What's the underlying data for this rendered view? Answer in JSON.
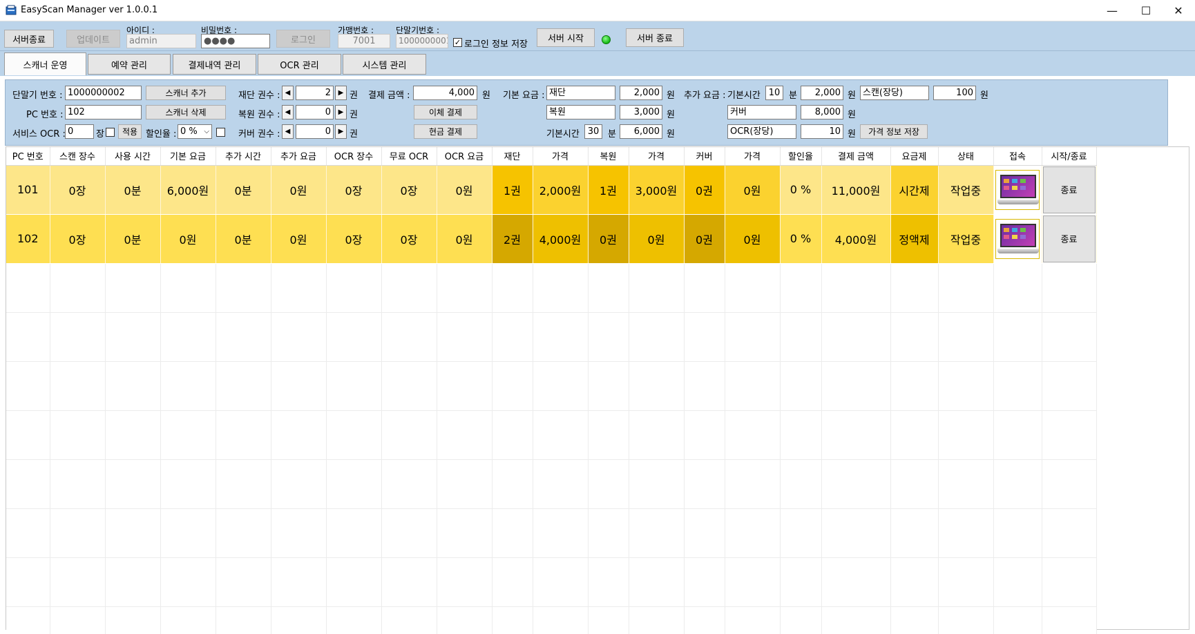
{
  "window": {
    "title": "EasyScan Manager ver 1.0.0.1",
    "minimize": "—",
    "maximize": "☐",
    "close": "✕"
  },
  "login_bar": {
    "server_exit_label": "서버종료",
    "update_label": "업데이트",
    "id_label": "아이디 :",
    "id_value": "admin",
    "password_label": "비밀번호 :",
    "password_value": "●●●●",
    "login_label": "로그인",
    "store_no_label": "가맹번호 :",
    "store_no_value": "7001",
    "terminal_no_label": "단말기번호 :",
    "terminal_no_value": "1000000001",
    "save_login_checked": "✓",
    "save_login_label": "로그인 정보 저장",
    "server_start_label": "서버 시작",
    "server_stop_label": "서버 종료",
    "status_led_color": "#14b814"
  },
  "tabs": [
    "스캐너 운영",
    "예약 관리",
    "결제내역 관리",
    "OCR 관리",
    "시스템 관리"
  ],
  "panel": {
    "terminal_label": "단말기 번호 :",
    "terminal_value": "1000000002",
    "add_scanner_label": "스캐너 추가",
    "pc_label": "PC 번호 :",
    "pc_value": "102",
    "delete_scanner_label": "스캐너 삭제",
    "service_ocr_label": "서비스 OCR :",
    "service_ocr_value": "0",
    "service_ocr_unit": "장",
    "apply_label": "적용",
    "discount_label": "할인율 :",
    "discount_value": "0 %",
    "cut_count_label": "재단 권수 :",
    "cut_count_value": "2",
    "copy_count_label": "복원 권수 :",
    "copy_count_value": "0",
    "cover_count_label": "커버 권수 :",
    "cover_count_value": "0",
    "count_unit": "권",
    "pay_amount_label": "결제 금액 :",
    "pay_amount_value": "4,000",
    "won": "원",
    "transfer_pay_label": "이체 결제",
    "cash_pay_label": "현금 결제",
    "base_fee_label": "기본 요금 :",
    "base_cut_name": "재단",
    "base_cut_price": "2,000",
    "base_copy_name": "복원",
    "base_copy_price": "3,000",
    "base_time_label": "기본시간",
    "base_time_value": "30",
    "base_time_unit": "분",
    "base_time_price": "6,000",
    "extra_fee_label": "추가 요금 :",
    "extra_time_label": "기본시간",
    "extra_time_value": "10",
    "extra_time_unit": "분",
    "extra_time_price": "2,000",
    "scan_name": "스캔(장당)",
    "scan_price": "100",
    "cover_name": "커버",
    "cover_price": "8,000",
    "ocr_name": "OCR(장당)",
    "ocr_price": "10",
    "save_price_label": "가격 정보 저장"
  },
  "grid": {
    "columns": [
      "PC 번호",
      "스캔 장수",
      "사용 시간",
      "기본 요금",
      "추가 시간",
      "추가 요금",
      "OCR 장수",
      "무료 OCR",
      "OCR 요금",
      "재단",
      "가격",
      "복원",
      "가격",
      "커버",
      "가격",
      "할인율",
      "결제 금액",
      "요금제",
      "상태",
      "접속",
      "시작/종료"
    ],
    "rows": [
      [
        "101",
        "0장",
        "0분",
        "6,000원",
        "0분",
        "0원",
        "0장",
        "0장",
        "0원",
        "1권",
        "2,000원",
        "1권",
        "3,000원",
        "0권",
        "0원",
        "0 %",
        "11,000원",
        "시간제",
        "작업중",
        "laptop-icon",
        "종료"
      ],
      [
        "102",
        "0장",
        "0분",
        "0원",
        "0분",
        "0원",
        "0장",
        "0장",
        "0원",
        "2권",
        "4,000원",
        "0권",
        "0원",
        "0권",
        "0원",
        "0 %",
        "4,000원",
        "정액제",
        "작업중",
        "laptop-icon",
        "종료"
      ]
    ],
    "colors": {
      "row1_light": "#fde689",
      "row1_mid": "#fbd22f",
      "row1_dark": "#f6c300",
      "row2_light": "#fedf52",
      "row2_mid": "#eec000",
      "row2_dark": "#d5a800"
    }
  }
}
